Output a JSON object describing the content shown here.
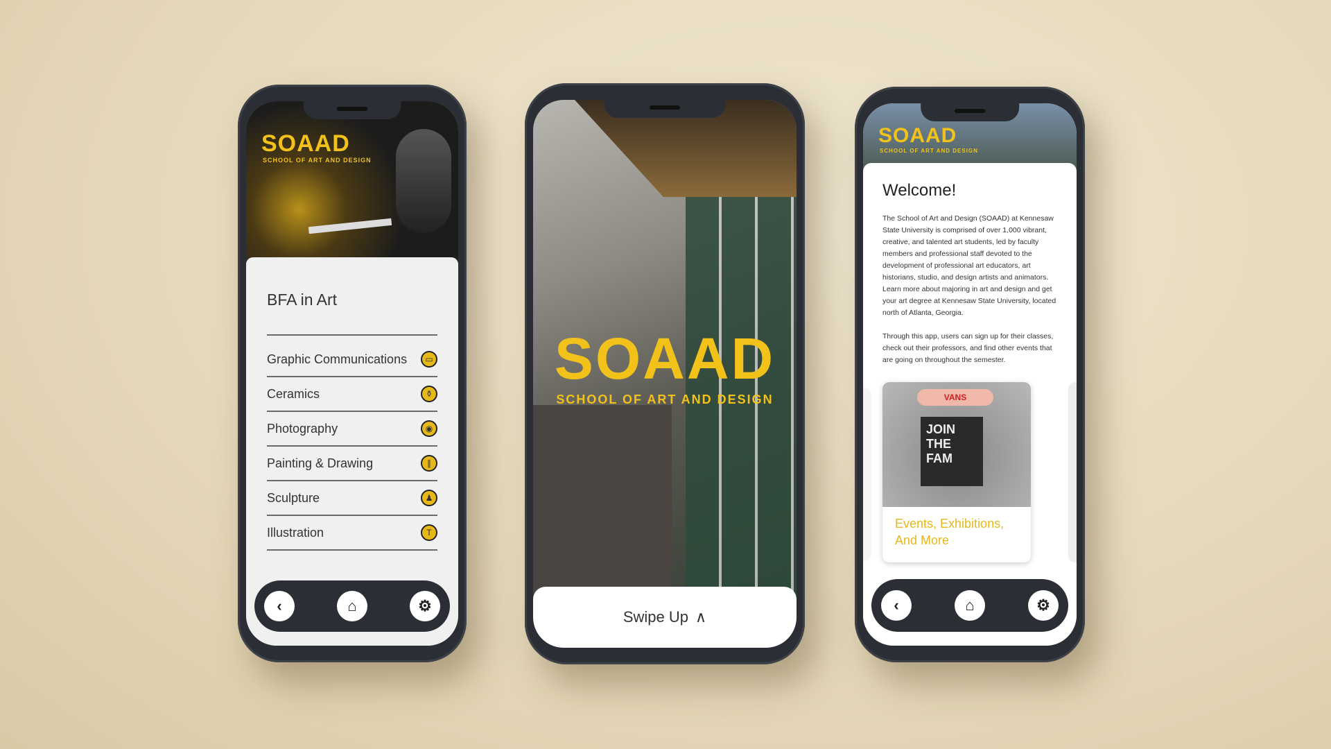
{
  "brand": {
    "logo": "SOAAD",
    "tagline": "SCHOOL OF ART AND DESIGN",
    "accent": "#f2c21b",
    "frame": "#2b2e34"
  },
  "left_phone": {
    "title": "BFA in Art",
    "items": [
      {
        "label": "Graphic Communications",
        "icon": "monitor-icon"
      },
      {
        "label": "Ceramics",
        "icon": "vase-icon"
      },
      {
        "label": "Photography",
        "icon": "camera-icon"
      },
      {
        "label": "Painting & Drawing",
        "icon": "brushes-icon"
      },
      {
        "label": "Sculpture",
        "icon": "bust-icon"
      },
      {
        "label": "Illustration",
        "icon": "pen-icon"
      }
    ]
  },
  "middle_phone": {
    "swipe_label": "Swipe Up",
    "swipe_icon": "chevron-up-icon"
  },
  "right_phone": {
    "title": "Welcome!",
    "body1": "The School of Art and Design (SOAAD) at Kennesaw State University is comprised of over 1,000 vibrant, creative, and talented art students, led by faculty members and professional staff devoted to the development of professional art educators, art historians, studio, and design artists and animators. Learn more about majoring in art and design and get your art degree at Kennesaw State University, located north of Atlanta, Georgia.",
    "body2": "Through this app, users can sign up for their classes, check out their professors, and find other events that are going on throughout the semester.",
    "card_label": "Events, Exhibitions, And More",
    "card_image_text": "JOIN THE FAM",
    "card_brand": "VANS"
  },
  "nav": {
    "back": "‹",
    "home": "⌂",
    "settings": "⚙"
  }
}
